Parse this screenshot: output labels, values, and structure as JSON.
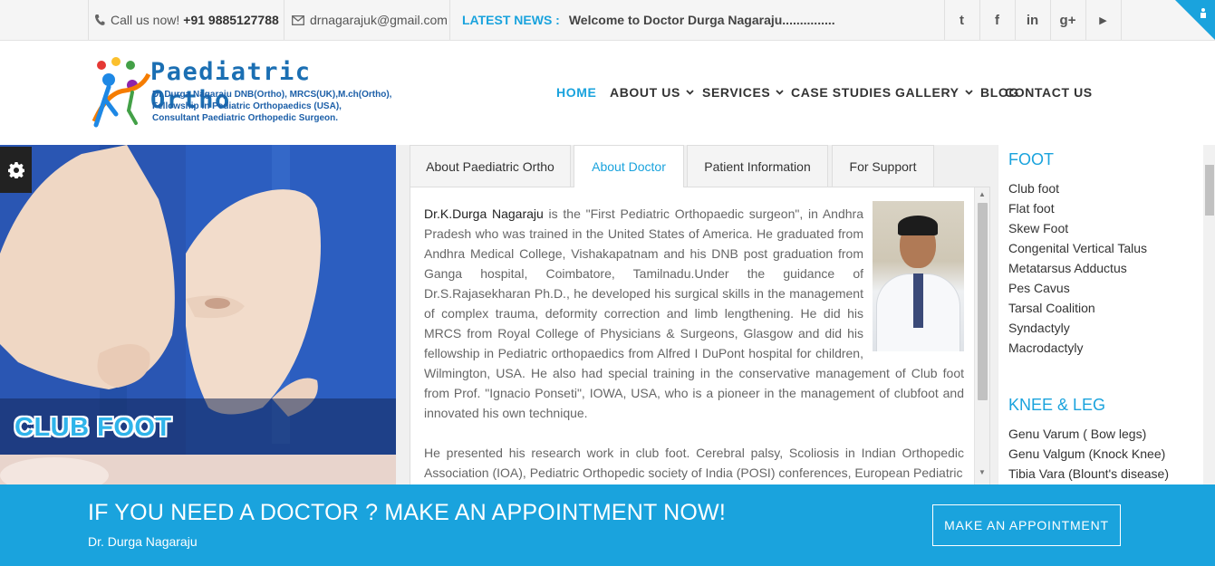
{
  "topbar": {
    "phone_label": "Call us now!",
    "phone_number": "+91 9885127788",
    "email": "drnagarajuk@gmail.com",
    "news_label": "LATEST NEWS :",
    "news_text": "Welcome to Doctor Durga Nagaraju...............",
    "social": [
      "twitter-icon",
      "facebook-icon",
      "linkedin-icon",
      "google-plus-icon",
      "youtube-icon"
    ],
    "social_glyphs": [
      "t",
      "f",
      "in",
      "g+",
      "▶"
    ]
  },
  "logo": {
    "title": "Paediatric Ortho",
    "lines": [
      "Dr.Durga Nagaraju DNB(Ortho), MRCS(UK),M.ch(Ortho),",
      "Fellowship in Pediatric Orthopaedics (USA),",
      "Consultant Paediatric Orthopedic Surgeon."
    ]
  },
  "nav": {
    "items": [
      {
        "label": "HOME",
        "active": true
      },
      {
        "label": "ABOUT US",
        "dropdown": true
      },
      {
        "label": "SERVICES",
        "dropdown": true
      },
      {
        "label": "CASE STUDIES"
      },
      {
        "label": "GALLERY",
        "dropdown": true
      },
      {
        "label": "BLOG"
      },
      {
        "label": "CONTACT US"
      }
    ]
  },
  "hero": {
    "caption": "CLUB FOOT"
  },
  "tabs": {
    "items": [
      "About Paediatric Ortho",
      "About Doctor",
      "Patient Information",
      "For Support"
    ],
    "active_index": 1,
    "doctor_name": "Dr.K.Durga Nagaraju",
    "para1": " is the \"First Pediatric Orthopaedic surgeon\", in Andhra Pradesh who was trained in the United States of America. He graduated from Andhra Medical College, Vishakapatnam and his DNB post graduation from Ganga hospital, Coimbatore, Tamilnadu.Under the guidance of Dr.S.Rajasekharan Ph.D., he developed his surgical skills in the management of complex trauma, deformity correction and limb lengthening. He did his MRCS from Royal College of Physicians & Surgeons, Glasgow and did his fellowship in Pediatric orthopaedics from Alfred I DuPont hospital for children, Wilmington, USA. He also had special training in the conservative management of Club foot from Prof. \"Ignacio Ponseti\", IOWA, USA, who is a pioneer in the management of clubfoot and innovated his own technique.",
    "para2": "He presented his research work in club foot. Cerebral palsy, Scoliosis in Indian Orthopedic Association (IOA), Pediatric Orthopedic society of India (POSI) conferences, European Pediatric"
  },
  "sidebar": {
    "foot_heading": "FOOT",
    "foot_items": [
      "Club foot",
      "Flat foot",
      "Skew Foot",
      "Congenital Vertical Talus",
      "Metatarsus Adductus",
      "Pes Cavus",
      "Tarsal Coalition",
      "Syndactyly",
      "Macrodactyly"
    ],
    "knee_heading": "KNEE & LEG",
    "knee_items": [
      "Genu Varum ( Bow legs)",
      "Genu Valgum (Knock Knee)",
      "Tibia Vara (Blount's disease)"
    ]
  },
  "banner": {
    "title": "IF YOU NEED A DOCTOR ? MAKE AN APPOINTMENT NOW!",
    "subtitle": "Dr. Durga Nagaraju",
    "button": "MAKE AN APPOINTMENT"
  },
  "colors": {
    "accent": "#1aa3dd",
    "hero_blue": "#2d5fbf"
  }
}
